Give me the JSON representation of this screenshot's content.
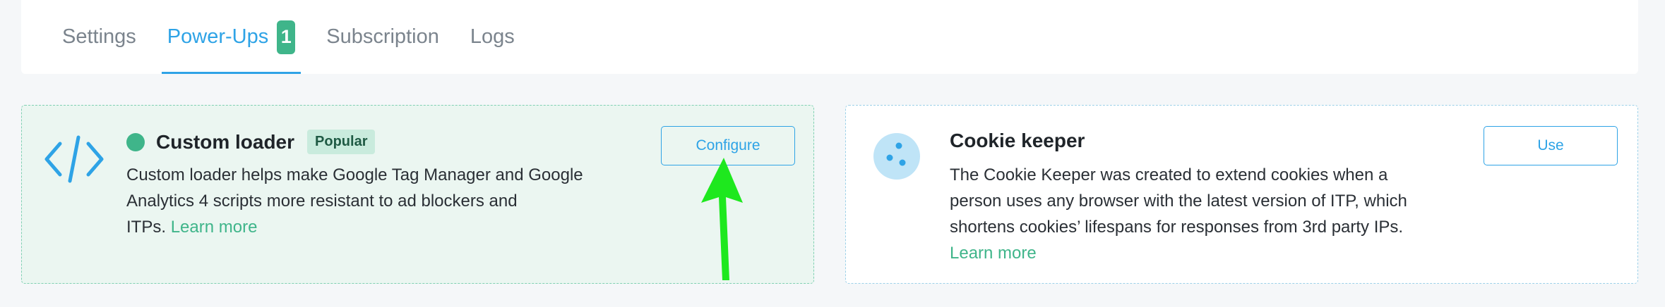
{
  "tabs": [
    {
      "label": "Settings",
      "active": false
    },
    {
      "label": "Power-Ups",
      "active": true,
      "badge": "1"
    },
    {
      "label": "Subscription",
      "active": false
    },
    {
      "label": "Logs",
      "active": false
    }
  ],
  "cards": [
    {
      "title": "Custom loader",
      "badge": "Popular",
      "status": "active",
      "icon": "code-icon",
      "description_lines": [
        "Custom loader helps make Google Tag Manager and Google",
        "Analytics 4 scripts more resistant to ad blockers and",
        "ITPs."
      ],
      "learn_more": "Learn more",
      "button_label": "Configure"
    },
    {
      "title": "Cookie keeper",
      "icon": "cookie-icon",
      "description_lines": [
        "The Cookie Keeper was created to extend cookies when a",
        "person uses any browser with the latest version of ITP, which",
        "shortens cookies’ lifespans for responses from 3rd party IPs."
      ],
      "learn_more": "Learn more",
      "button_label": "Use"
    }
  ],
  "colors": {
    "accent_blue": "#2ea3e6",
    "accent_green": "#3fb58a",
    "annotation_arrow": "#1ee81e"
  }
}
